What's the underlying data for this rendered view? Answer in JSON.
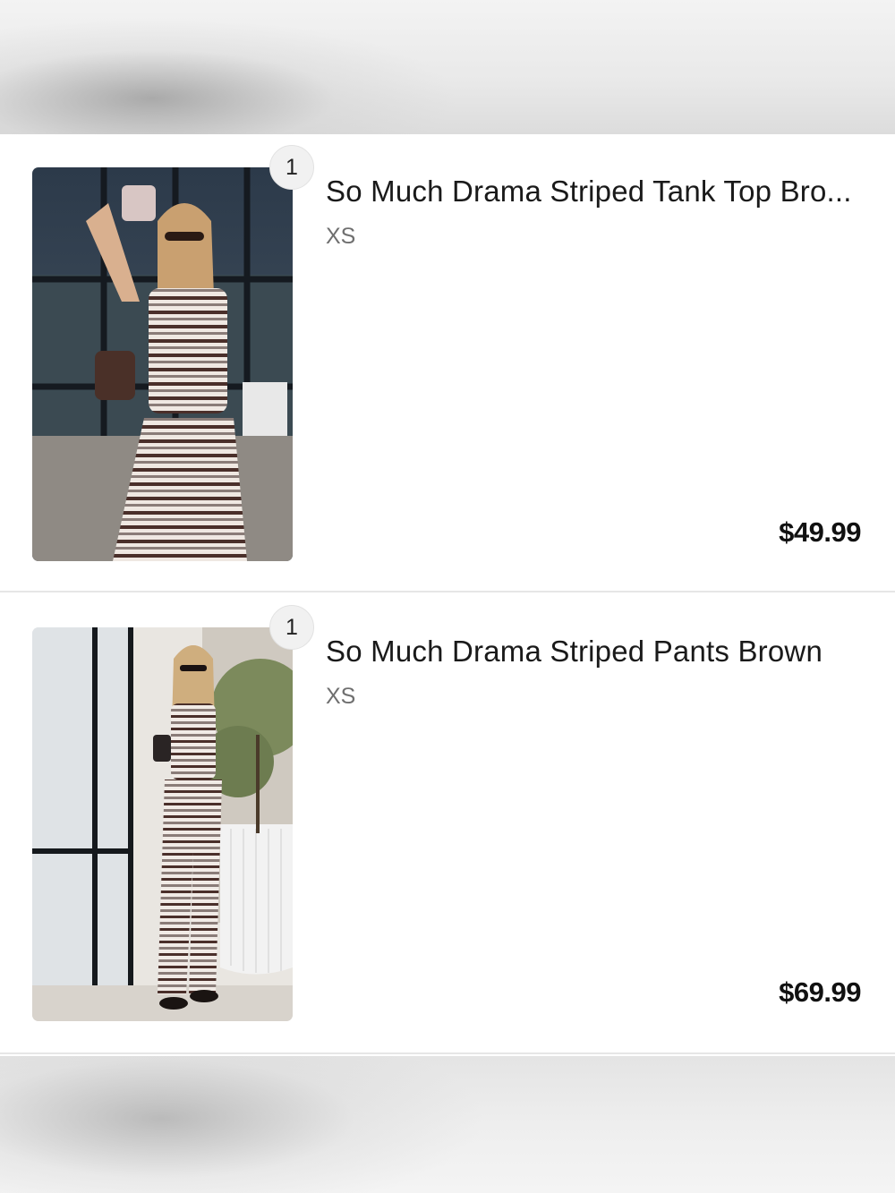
{
  "cart": {
    "items": [
      {
        "quantity": "1",
        "title": "So Much Drama Striped Tank Top Bro...",
        "size": "XS",
        "price": "$49.99",
        "image_desc": "product-photo-tank-top"
      },
      {
        "quantity": "1",
        "title": "So Much Drama Striped Pants Brown",
        "size": "XS",
        "price": "$69.99",
        "image_desc": "product-photo-pants"
      }
    ]
  },
  "colors": {
    "background": "#ffffff",
    "divider": "#e6e6e6",
    "title": "#1a1a1a",
    "size": "#6f6f6f",
    "price": "#111111",
    "badge": "#f1f1f1"
  }
}
